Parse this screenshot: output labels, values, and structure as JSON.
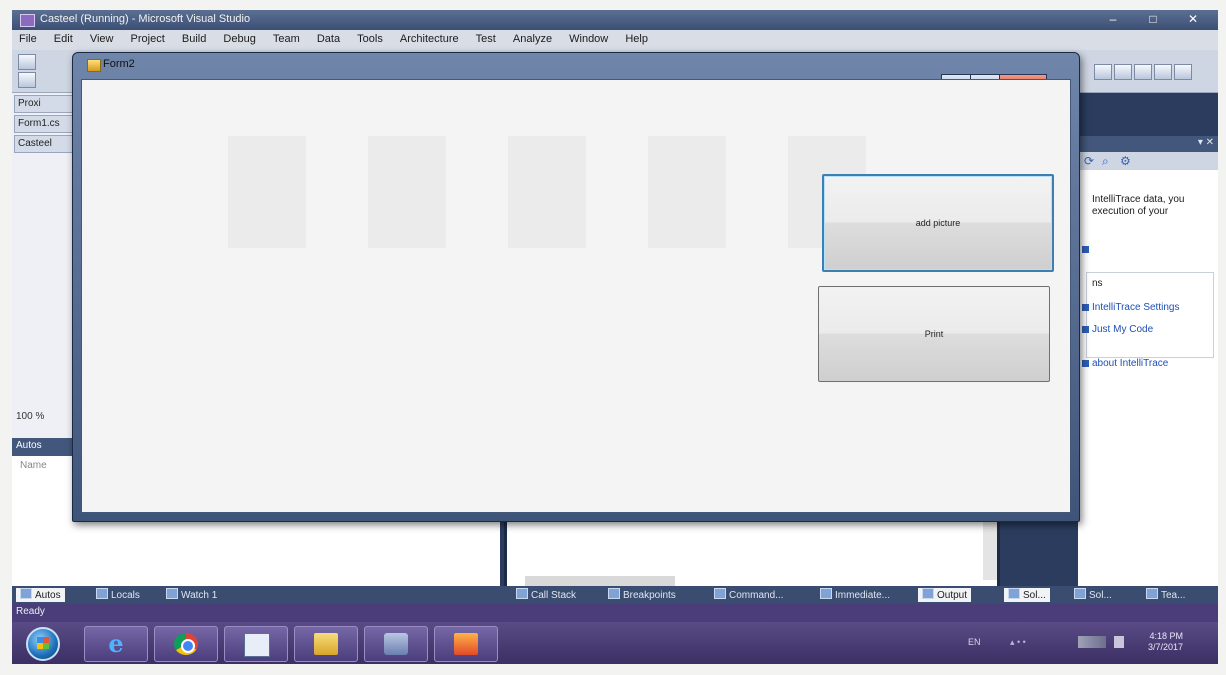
{
  "vs": {
    "title": "Casteel (Running) - Microsoft Visual Studio",
    "menu": [
      "File",
      "Edit",
      "View",
      "Project",
      "Build",
      "Debug",
      "Team",
      "Data",
      "Tools",
      "Architecture",
      "Test",
      "Analyze",
      "Window",
      "Help"
    ],
    "left_tabs": [
      "Proxi",
      "Form1.cs",
      "Casteel"
    ],
    "zoom": "100 %",
    "autos_panel_title": "Autos",
    "autos_name_header": "Name",
    "intellitrace": {
      "line1": "IntelliTrace data, you",
      "line2": "execution of your",
      "header": "ns",
      "link1": "IntelliTrace Settings",
      "link2": "Just My Code",
      "link3": "about IntelliTrace"
    },
    "bottom_tabs_left": [
      "Autos",
      "Locals",
      "Watch 1"
    ],
    "bottom_tabs_right": [
      "Call Stack",
      "Breakpoints",
      "Command...",
      "Immediate...",
      "Output",
      "Sol...",
      "Tea..."
    ],
    "status": "Ready"
  },
  "form": {
    "title": "Form2",
    "buttons": {
      "add_picture": "add picture",
      "print": "Print"
    }
  },
  "taskbar": {
    "apps": [
      "Internet Explorer",
      "Google Chrome",
      "Visual Studio",
      "Windows Explorer",
      "Media Player",
      "Application"
    ],
    "language": "EN",
    "clock_time": "4:18 PM",
    "clock_date": "3/7/2017"
  }
}
